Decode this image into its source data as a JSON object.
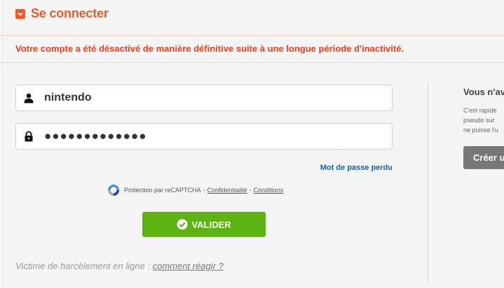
{
  "header": {
    "title": "Se connecter"
  },
  "alert": {
    "message": "Votre compte a été désactivé de manière définitive suite à une longue période d'inactivité."
  },
  "form": {
    "username_value": "nintendo",
    "password_value": "●●●●●●●●●●●●●",
    "forgot_label": "Mot de passe perdu",
    "submit_label": "VALIDER"
  },
  "captcha": {
    "text": "Protection par reCAPTCHA",
    "separator": "-",
    "privacy_label": "Confidentialité",
    "terms_label": "Conditions"
  },
  "harassment": {
    "text": "Victime de harcèlement en ligne :",
    "link_label": "comment réagir ?"
  },
  "side": {
    "title": "Vous n'av",
    "lines": [
      "C'est rapide",
      "pseudo sur",
      "ne puisse l'u"
    ],
    "create_label": "Créer u"
  },
  "colors": {
    "accent": "#f05a28",
    "alert": "#e8401c",
    "submit": "#5cb312",
    "link": "#1a5ea8",
    "secondary_button": "#777777"
  },
  "icons": {
    "title": "chevron-down-icon",
    "username": "user-icon",
    "password": "lock-icon",
    "captcha": "recaptcha-icon",
    "submit": "check-circle-icon"
  }
}
